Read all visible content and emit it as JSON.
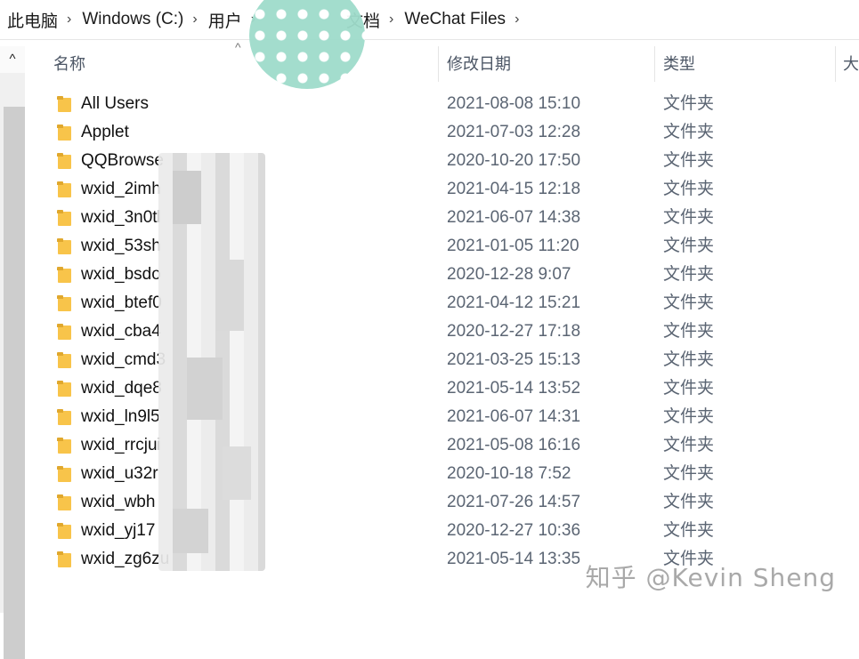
{
  "breadcrumb": [
    {
      "label": "此电脑"
    },
    {
      "label": "Windows  (C:)"
    },
    {
      "label": "用户"
    },
    {
      "label": ""
    },
    {
      "label": "文档"
    },
    {
      "label": "WeChat Files"
    }
  ],
  "columns": {
    "name": "名称",
    "date": "修改日期",
    "type": "类型",
    "size": "大"
  },
  "scroll_up_glyph": "^",
  "sort_glyph": "^",
  "rows": [
    {
      "name": "All Users",
      "date": "2021-08-08 15:10",
      "type": "文件夹"
    },
    {
      "name": "Applet",
      "date": "2021-07-03 12:28",
      "type": "文件夹"
    },
    {
      "name": "QQBrowse",
      "date": "2020-10-20 17:50",
      "type": "文件夹"
    },
    {
      "name": "wxid_2imh",
      "date": "2021-04-15 12:18",
      "type": "文件夹"
    },
    {
      "name": "wxid_3n0tl",
      "date": "2021-06-07 14:38",
      "type": "文件夹"
    },
    {
      "name": "wxid_53sh",
      "date": "2021-01-05 11:20",
      "type": "文件夹"
    },
    {
      "name": "wxid_bsdo",
      "date": "2020-12-28 9:07",
      "type": "文件夹"
    },
    {
      "name": "wxid_btef0",
      "date": "2021-04-12 15:21",
      "type": "文件夹"
    },
    {
      "name": "wxid_cba4",
      "date": "2020-12-27 17:18",
      "type": "文件夹"
    },
    {
      "name": "wxid_cmd3",
      "date": "2021-03-25 15:13",
      "type": "文件夹"
    },
    {
      "name": "wxid_dqe8",
      "date": "2021-05-14 13:52",
      "type": "文件夹"
    },
    {
      "name": "wxid_ln9l5",
      "date": "2021-06-07 14:31",
      "type": "文件夹"
    },
    {
      "name": "wxid_rrcjui",
      "date": "2021-05-08 16:16",
      "type": "文件夹"
    },
    {
      "name": "wxid_u32r",
      "date": "2020-10-18 7:52",
      "type": "文件夹"
    },
    {
      "name": "wxid_wbh",
      "date": "2021-07-26 14:57",
      "type": "文件夹"
    },
    {
      "name": "wxid_yj17",
      "date": "2020-12-27 10:36",
      "type": "文件夹"
    },
    {
      "name": "wxid_zg6zu",
      "date": "2021-05-14 13:35",
      "type": "文件夹"
    }
  ],
  "watermark": "知乎 @Kevin Sheng",
  "icons": {
    "folder": "folder-icon",
    "separator": "chevron-right-icon"
  },
  "colors": {
    "folder": "#f8c44a",
    "sticker": "#9fdccb"
  }
}
